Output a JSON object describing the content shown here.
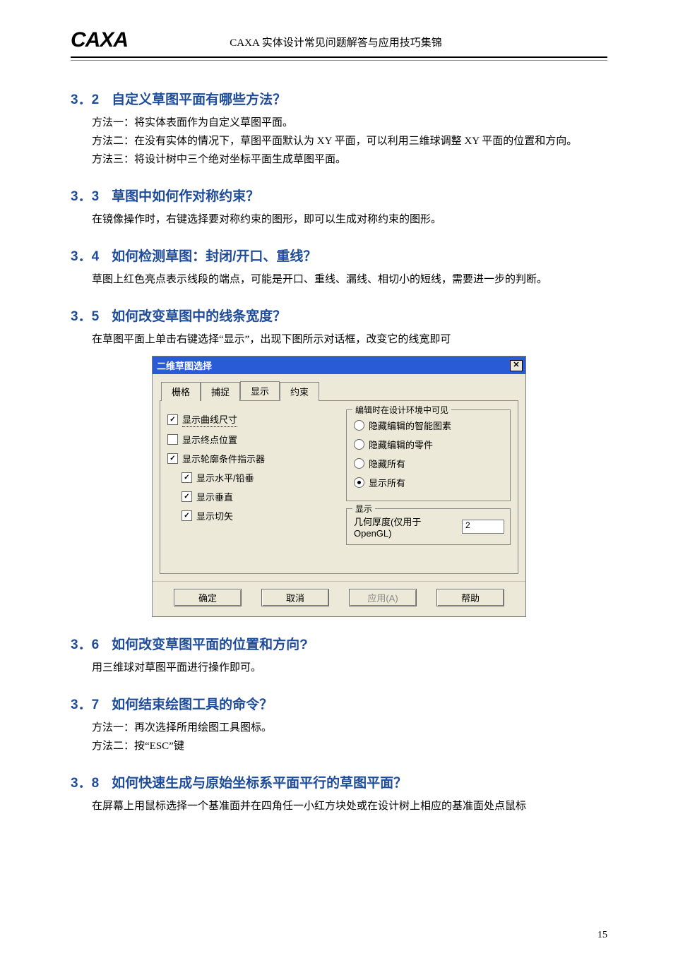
{
  "header": {
    "logo": "CAXA",
    "title": "CAXA 实体设计常见问题解答与应用技巧集锦"
  },
  "sections": [
    {
      "num": "3．2",
      "title": "自定义草图平面有哪些方法？",
      "paras": [
        "方法一：将实体表面作为自定义草图平面。",
        "方法二：在没有实体的情况下，草图平面默认为 XY 平面，可以利用三维球调整 XY 平面的位置和方向。",
        "方法三：将设计树中三个绝对坐标平面生成草图平面。"
      ]
    },
    {
      "num": "3．3",
      "title": "草图中如何作对称约束？",
      "paras": [
        "在镜像操作时，右键选择要对称约束的图形，即可以生成对称约束的图形。"
      ]
    },
    {
      "num": "3．4",
      "title": "如何检测草图：封闭/开口、重线？",
      "paras": [
        "草图上红色亮点表示线段的端点，可能是开口、重线、漏线、相切小的短线，需要进一步的判断。"
      ]
    },
    {
      "num": "3．5",
      "title": "如何改变草图中的线条宽度？",
      "paras": [
        "在草图平面上单击右键选择“显示”，出现下图所示对话框，改变它的线宽即可"
      ]
    },
    {
      "num": "3．6",
      "title": "如何改变草图平面的位置和方向?",
      "paras": [
        "用三维球对草图平面进行操作即可。"
      ]
    },
    {
      "num": "3．7",
      "title": "如何结束绘图工具的命令？",
      "paras": [
        "方法一：再次选择所用绘图工具图标。",
        "方法二：按“ESC”键"
      ]
    },
    {
      "num": "3．8",
      "title": "如何快速生成与原始坐标系平面平行的草图平面？",
      "paras": [
        "在屏幕上用鼠标选择一个基准面并在四角任一小红方块处或在设计树上相应的基准面处点鼠标"
      ]
    }
  ],
  "dialog": {
    "title": "二维草图选择",
    "close_label": "✕",
    "tabs": {
      "t0": "栅格",
      "t1": "捕捉",
      "t2": "显示",
      "t3": "约束"
    },
    "left": {
      "c0": "显示曲线尺寸",
      "c1": "显示终点位置",
      "c2": "显示轮廓条件指示器",
      "c3": "显示水平/铅垂",
      "c4": "显示垂直",
      "c5": "显示切矢"
    },
    "right": {
      "group1_title": "编辑时在设计环境中可见",
      "r0": "隐藏编辑的智能图素",
      "r1": "隐藏编辑的零件",
      "r2": "隐藏所有",
      "r3": "显示所有",
      "group2_title": "显示",
      "thickness_label": "几何厚度(仅用于OpenGL)",
      "thickness_value": "2"
    },
    "buttons": {
      "ok": "确定",
      "cancel": "取消",
      "apply": "应用(A)",
      "help": "帮助"
    }
  },
  "page_number": "15"
}
